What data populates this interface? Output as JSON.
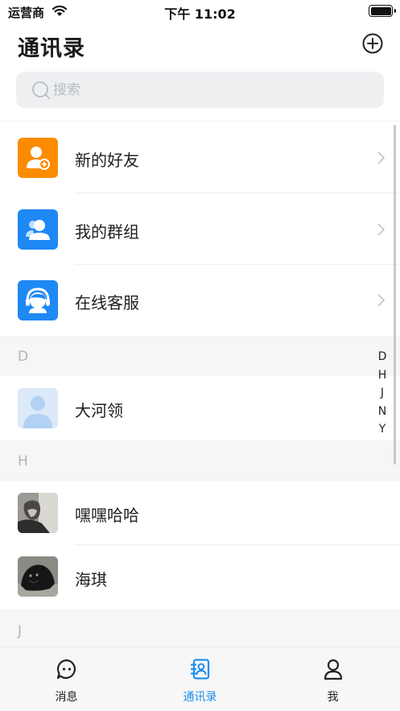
{
  "status_bar": {
    "carrier": "运营商",
    "time": "下午 11:02",
    "battery_level": 1.0
  },
  "header": {
    "title": "通讯录"
  },
  "search": {
    "placeholder": "搜索",
    "value": ""
  },
  "quick_entries": [
    {
      "label": "新的好友",
      "icon": "add-friend-icon",
      "color": "#fb8c00"
    },
    {
      "label": "我的群组",
      "icon": "group-icon",
      "color": "#1e88f5"
    },
    {
      "label": "在线客服",
      "icon": "customer-service-icon",
      "color": "#1e88f5"
    }
  ],
  "sections": [
    {
      "letter": "D",
      "contacts": [
        {
          "name": "大河领",
          "avatar": "default-avatar"
        }
      ]
    },
    {
      "letter": "H",
      "contacts": [
        {
          "name": "嘿嘿哈哈",
          "avatar": "photo-avatar"
        },
        {
          "name": "海琪",
          "avatar": "panther-photo-avatar"
        }
      ]
    },
    {
      "letter": "J",
      "contacts": []
    }
  ],
  "index_bar": [
    "D",
    "H",
    "J",
    "N",
    "Y"
  ],
  "tabs": [
    {
      "label": "消息",
      "icon": "message-icon",
      "active": false
    },
    {
      "label": "通讯录",
      "icon": "contacts-icon",
      "active": true
    },
    {
      "label": "我",
      "icon": "profile-icon",
      "active": false
    }
  ],
  "colors": {
    "accent": "#1f8ef1",
    "orange": "#fb8c00",
    "blue": "#1e88f5"
  }
}
